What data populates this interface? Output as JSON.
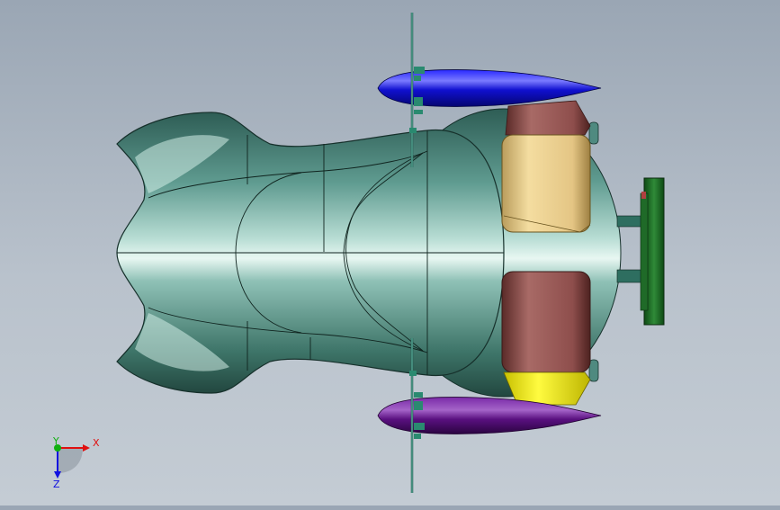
{
  "viewport": {
    "model_colors": {
      "body_green": "#3f7a70",
      "body_highlight": "#d4efe8",
      "pod_blue": "#1a1ad8",
      "pod_purple": "#5a1080",
      "battery_tan": "#e6c98a",
      "block_brown": "#8e4e4c",
      "block_yellow": "#f2ec00",
      "mount_green": "#1f6a28"
    }
  },
  "triad": {
    "x_label": "X",
    "y_label": "Y",
    "z_label": "Z",
    "x_color": "#e01010",
    "y_color": "#10b010",
    "z_color": "#1010e0"
  }
}
